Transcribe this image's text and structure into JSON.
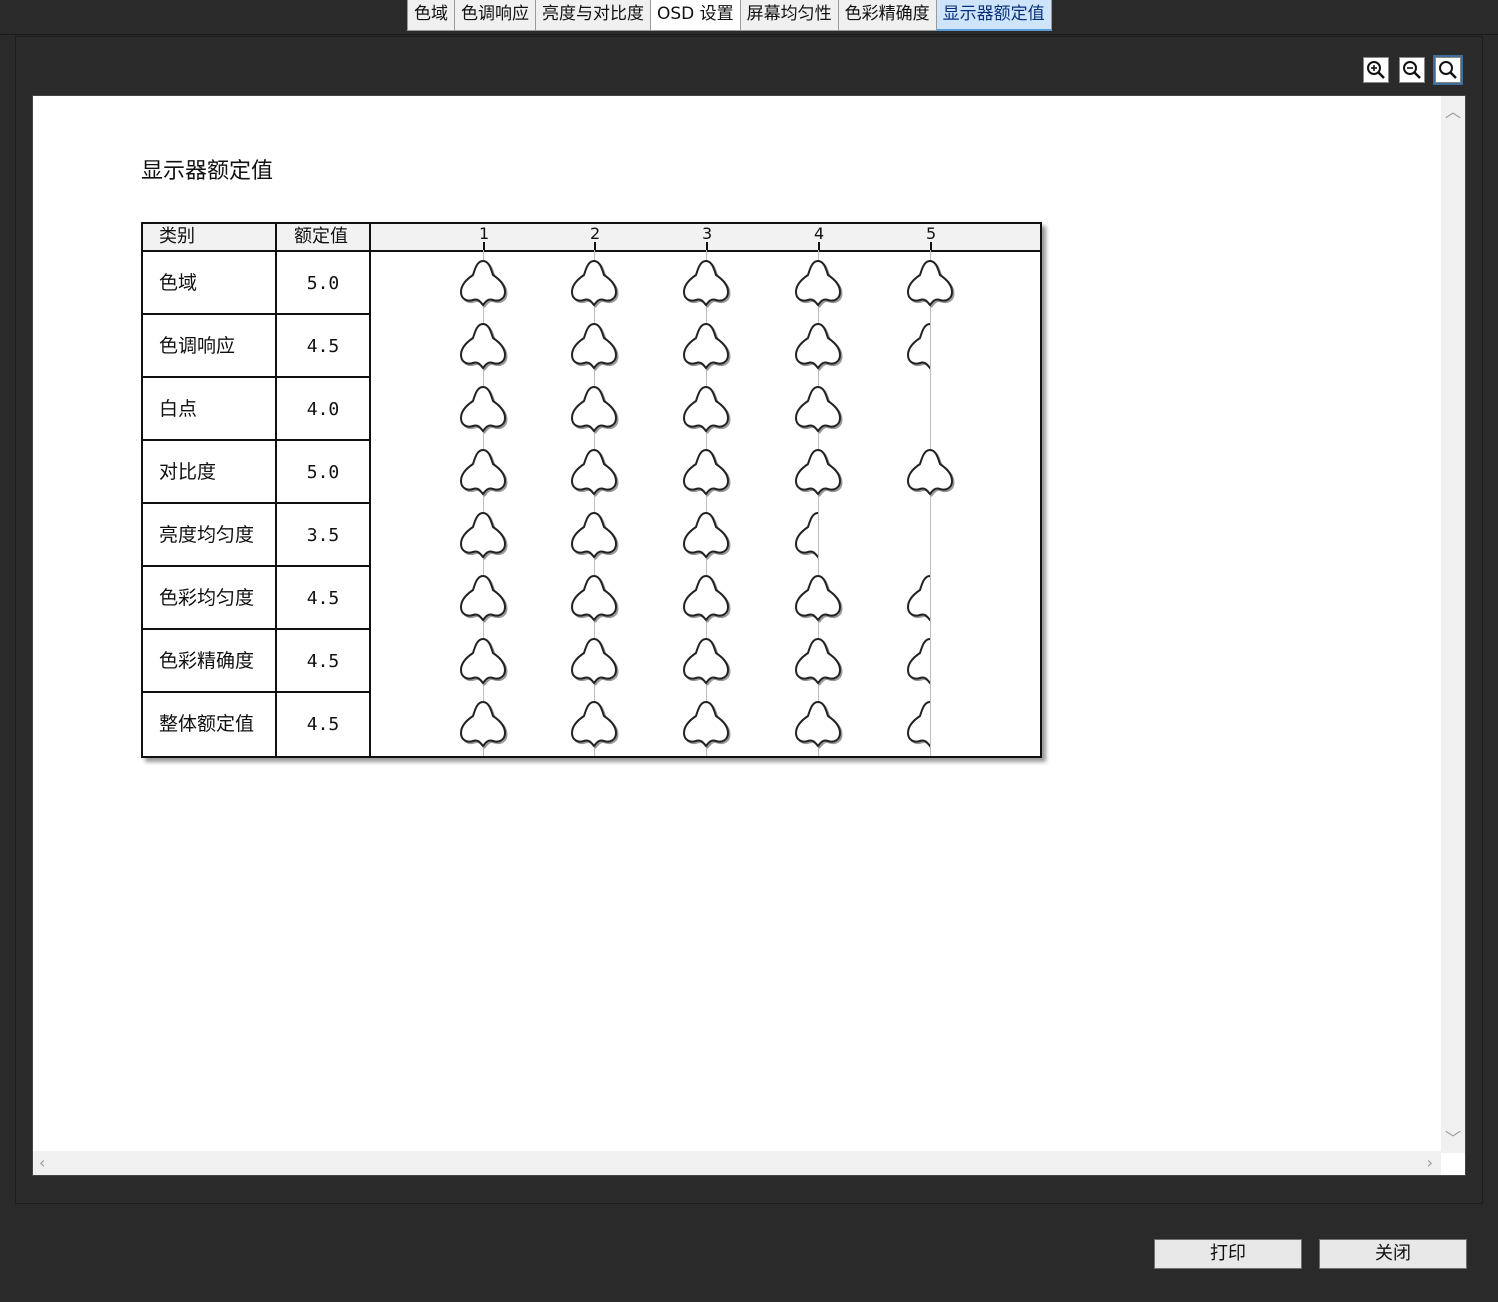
{
  "tabs": [
    {
      "label": "色域"
    },
    {
      "label": "色调响应"
    },
    {
      "label": "亮度与对比度"
    },
    {
      "label": "OSD 设置"
    },
    {
      "label": "屏幕均匀性"
    },
    {
      "label": "色彩精确度"
    },
    {
      "label": "显示器额定值"
    }
  ],
  "active_tab": 6,
  "zoom": {
    "icons": [
      "zoom-in-icon",
      "zoom-out-icon",
      "zoom-fit-icon"
    ]
  },
  "report": {
    "title": "显示器额定值",
    "headers": {
      "category": "类别",
      "rating": "额定值",
      "scale": [
        "1",
        "2",
        "3",
        "4",
        "5"
      ]
    },
    "max_stars": 5,
    "rows": [
      {
        "category": "色域",
        "rating": "5.0",
        "value": 5.0
      },
      {
        "category": "色调响应",
        "rating": "4.5",
        "value": 4.5
      },
      {
        "category": "白点",
        "rating": "4.0",
        "value": 4.0
      },
      {
        "category": "对比度",
        "rating": "5.0",
        "value": 5.0
      },
      {
        "category": "亮度均匀度",
        "rating": "3.5",
        "value": 3.5
      },
      {
        "category": "色彩均匀度",
        "rating": "4.5",
        "value": 4.5
      },
      {
        "category": "色彩精确度",
        "rating": "4.5",
        "value": 4.5
      },
      {
        "category": "整体额定值",
        "rating": "4.5",
        "value": 4.5
      }
    ]
  },
  "buttons": {
    "print": "打印",
    "close": "关闭"
  }
}
